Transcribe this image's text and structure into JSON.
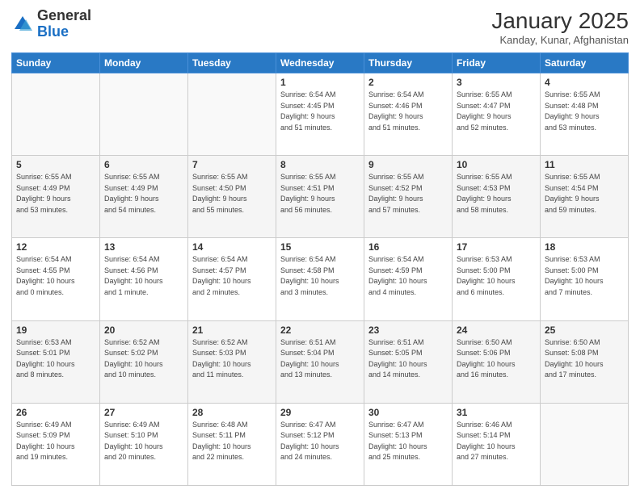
{
  "header": {
    "logo_line1": "General",
    "logo_line2": "Blue",
    "title": "January 2025",
    "subtitle": "Kanday, Kunar, Afghanistan"
  },
  "weekdays": [
    "Sunday",
    "Monday",
    "Tuesday",
    "Wednesday",
    "Thursday",
    "Friday",
    "Saturday"
  ],
  "weeks": [
    [
      {
        "day": "",
        "info": ""
      },
      {
        "day": "",
        "info": ""
      },
      {
        "day": "",
        "info": ""
      },
      {
        "day": "1",
        "info": "Sunrise: 6:54 AM\nSunset: 4:45 PM\nDaylight: 9 hours\nand 51 minutes."
      },
      {
        "day": "2",
        "info": "Sunrise: 6:54 AM\nSunset: 4:46 PM\nDaylight: 9 hours\nand 51 minutes."
      },
      {
        "day": "3",
        "info": "Sunrise: 6:55 AM\nSunset: 4:47 PM\nDaylight: 9 hours\nand 52 minutes."
      },
      {
        "day": "4",
        "info": "Sunrise: 6:55 AM\nSunset: 4:48 PM\nDaylight: 9 hours\nand 53 minutes."
      }
    ],
    [
      {
        "day": "5",
        "info": "Sunrise: 6:55 AM\nSunset: 4:49 PM\nDaylight: 9 hours\nand 53 minutes."
      },
      {
        "day": "6",
        "info": "Sunrise: 6:55 AM\nSunset: 4:49 PM\nDaylight: 9 hours\nand 54 minutes."
      },
      {
        "day": "7",
        "info": "Sunrise: 6:55 AM\nSunset: 4:50 PM\nDaylight: 9 hours\nand 55 minutes."
      },
      {
        "day": "8",
        "info": "Sunrise: 6:55 AM\nSunset: 4:51 PM\nDaylight: 9 hours\nand 56 minutes."
      },
      {
        "day": "9",
        "info": "Sunrise: 6:55 AM\nSunset: 4:52 PM\nDaylight: 9 hours\nand 57 minutes."
      },
      {
        "day": "10",
        "info": "Sunrise: 6:55 AM\nSunset: 4:53 PM\nDaylight: 9 hours\nand 58 minutes."
      },
      {
        "day": "11",
        "info": "Sunrise: 6:55 AM\nSunset: 4:54 PM\nDaylight: 9 hours\nand 59 minutes."
      }
    ],
    [
      {
        "day": "12",
        "info": "Sunrise: 6:54 AM\nSunset: 4:55 PM\nDaylight: 10 hours\nand 0 minutes."
      },
      {
        "day": "13",
        "info": "Sunrise: 6:54 AM\nSunset: 4:56 PM\nDaylight: 10 hours\nand 1 minute."
      },
      {
        "day": "14",
        "info": "Sunrise: 6:54 AM\nSunset: 4:57 PM\nDaylight: 10 hours\nand 2 minutes."
      },
      {
        "day": "15",
        "info": "Sunrise: 6:54 AM\nSunset: 4:58 PM\nDaylight: 10 hours\nand 3 minutes."
      },
      {
        "day": "16",
        "info": "Sunrise: 6:54 AM\nSunset: 4:59 PM\nDaylight: 10 hours\nand 4 minutes."
      },
      {
        "day": "17",
        "info": "Sunrise: 6:53 AM\nSunset: 5:00 PM\nDaylight: 10 hours\nand 6 minutes."
      },
      {
        "day": "18",
        "info": "Sunrise: 6:53 AM\nSunset: 5:00 PM\nDaylight: 10 hours\nand 7 minutes."
      }
    ],
    [
      {
        "day": "19",
        "info": "Sunrise: 6:53 AM\nSunset: 5:01 PM\nDaylight: 10 hours\nand 8 minutes."
      },
      {
        "day": "20",
        "info": "Sunrise: 6:52 AM\nSunset: 5:02 PM\nDaylight: 10 hours\nand 10 minutes."
      },
      {
        "day": "21",
        "info": "Sunrise: 6:52 AM\nSunset: 5:03 PM\nDaylight: 10 hours\nand 11 minutes."
      },
      {
        "day": "22",
        "info": "Sunrise: 6:51 AM\nSunset: 5:04 PM\nDaylight: 10 hours\nand 13 minutes."
      },
      {
        "day": "23",
        "info": "Sunrise: 6:51 AM\nSunset: 5:05 PM\nDaylight: 10 hours\nand 14 minutes."
      },
      {
        "day": "24",
        "info": "Sunrise: 6:50 AM\nSunset: 5:06 PM\nDaylight: 10 hours\nand 16 minutes."
      },
      {
        "day": "25",
        "info": "Sunrise: 6:50 AM\nSunset: 5:08 PM\nDaylight: 10 hours\nand 17 minutes."
      }
    ],
    [
      {
        "day": "26",
        "info": "Sunrise: 6:49 AM\nSunset: 5:09 PM\nDaylight: 10 hours\nand 19 minutes."
      },
      {
        "day": "27",
        "info": "Sunrise: 6:49 AM\nSunset: 5:10 PM\nDaylight: 10 hours\nand 20 minutes."
      },
      {
        "day": "28",
        "info": "Sunrise: 6:48 AM\nSunset: 5:11 PM\nDaylight: 10 hours\nand 22 minutes."
      },
      {
        "day": "29",
        "info": "Sunrise: 6:47 AM\nSunset: 5:12 PM\nDaylight: 10 hours\nand 24 minutes."
      },
      {
        "day": "30",
        "info": "Sunrise: 6:47 AM\nSunset: 5:13 PM\nDaylight: 10 hours\nand 25 minutes."
      },
      {
        "day": "31",
        "info": "Sunrise: 6:46 AM\nSunset: 5:14 PM\nDaylight: 10 hours\nand 27 minutes."
      },
      {
        "day": "",
        "info": ""
      }
    ]
  ]
}
